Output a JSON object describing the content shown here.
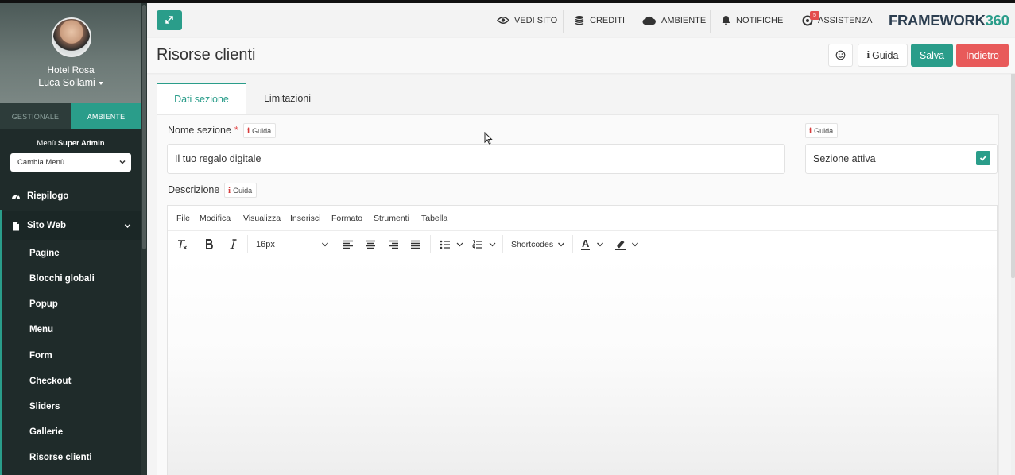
{
  "sidebar": {
    "hotel": "Hotel Rosa",
    "user": "Luca Sollami",
    "tabs": [
      "GESTIONALE",
      "AMBIENTE"
    ],
    "menu_title_prefix": "Menù",
    "menu_title_bold": "Super Admin",
    "menu_select": "Cambia Menù",
    "nav": [
      {
        "label": "Riepilogo",
        "icon": "dashboard-icon"
      },
      {
        "label": "Sito Web",
        "icon": "file-icon"
      }
    ],
    "subitems": [
      "Pagine",
      "Blocchi globali",
      "Popup",
      "Menu",
      "Form",
      "Checkout",
      "Sliders",
      "Gallerie",
      "Risorse clienti"
    ]
  },
  "topbar": {
    "links": [
      "VEDI SITO",
      "CREDITI",
      "AMBIENTE",
      "NOTIFICHE",
      "ASSISTENZA"
    ],
    "badge": "5",
    "brand_main": "FRAMEWORK",
    "brand_num": "360"
  },
  "page": {
    "title": "Risorse clienti",
    "guida": "Guida",
    "salva": "Salva",
    "indietro": "Indietro"
  },
  "tabs": [
    "Dati sezione",
    "Limitazioni"
  ],
  "form": {
    "nome_label": "Nome sezione",
    "nome_required": "*",
    "nome_value": "Il tuo regalo digitale",
    "guida_small": "Guida",
    "sezione_attiva_label": "Sezione attiva",
    "sezione_attiva_checked": true,
    "descrizione_label": "Descrizione"
  },
  "editor": {
    "menu": [
      "File",
      "Modifica",
      "Visualizza",
      "Inserisci",
      "Formato",
      "Strumenti",
      "Tabella"
    ],
    "font_size": "16px",
    "shortcodes": "Shortcodes",
    "color_letter": "A"
  },
  "colors": {
    "accent": "#2a9d8a",
    "danger": "#e85a5a",
    "sidebar": "#1f2b2a"
  }
}
